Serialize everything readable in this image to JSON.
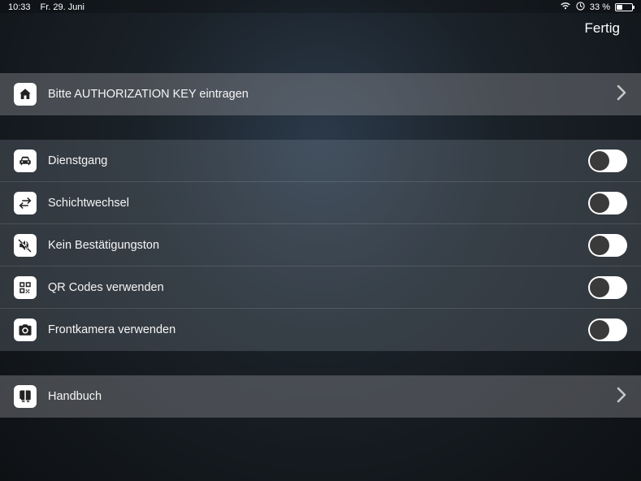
{
  "statusbar": {
    "time": "10:33",
    "date": "Fr. 29. Juni",
    "battery_text": "33 %",
    "battery_level": 33
  },
  "header": {
    "done_label": "Fertig"
  },
  "sections": {
    "auth": {
      "label": "Bitte AUTHORIZATION KEY eintragen"
    },
    "settings": [
      {
        "id": "dienstgang",
        "label": "Dienstgang",
        "icon": "car",
        "toggle": false
      },
      {
        "id": "schicht",
        "label": "Schichtwechsel",
        "icon": "swap",
        "toggle": false
      },
      {
        "id": "ton",
        "label": "Kein Bestätigungston",
        "icon": "mute",
        "toggle": false
      },
      {
        "id": "qr",
        "label": "QR Codes verwenden",
        "icon": "qr",
        "toggle": false
      },
      {
        "id": "frontcam",
        "label": "Frontkamera verwenden",
        "icon": "camera",
        "toggle": false
      }
    ],
    "manual": {
      "label": "Handbuch"
    }
  }
}
